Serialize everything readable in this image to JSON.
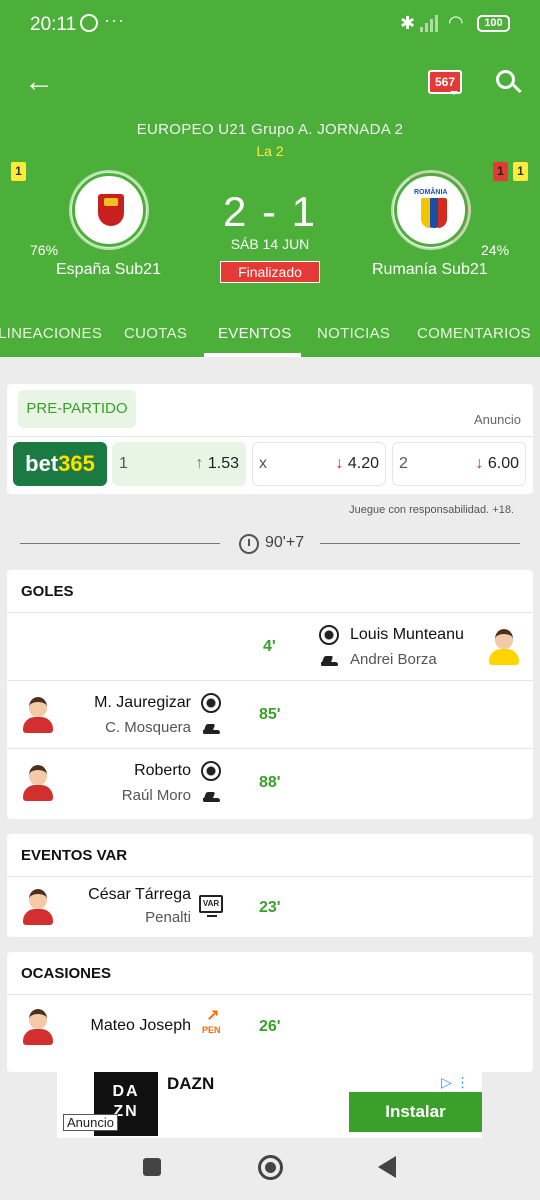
{
  "status_bar": {
    "time": "20:11",
    "dots": "···",
    "battery": "100"
  },
  "header": {
    "chat_count": "567",
    "competition": "EUROPEO U21 Grupo A.  JORNADA 2",
    "round": "La 2"
  },
  "match": {
    "home": {
      "name": "España Sub21",
      "pct": "76%",
      "yellow_cards": "1"
    },
    "away": {
      "name": "Rumanía Sub21",
      "pct": "24%",
      "red_cards": "1",
      "yellow_cards": "1",
      "crest_text": "ROMÂNIA"
    },
    "score": "2 - 1",
    "date": "SÁB 14 JUN",
    "status": "Finalizado",
    "colors": {
      "header_green": "#4caf3a",
      "status_red": "#e53935",
      "round_yellow": "#ffeb3b"
    }
  },
  "tabs": [
    "LINEACIONES",
    "CUOTAS",
    "EVENTOS",
    "NOTICIAS",
    "COMENTARIOS"
  ],
  "active_tab": "EVENTOS",
  "odds": {
    "label": "PRE-PARTIDO",
    "ad_label": "Anuncio",
    "bookmaker_a": "bet",
    "bookmaker_b": "365",
    "items": [
      {
        "key": "1",
        "arrow": "↑",
        "value": "1.53",
        "trend": "up"
      },
      {
        "key": "x",
        "arrow": "↓",
        "value": "4.20",
        "trend": "down"
      },
      {
        "key": "2",
        "arrow": "↓",
        "value": "6.00",
        "trend": "down"
      }
    ],
    "responsible": "Juegue con responsabilidad. +18."
  },
  "timer": {
    "minute": "90'+7"
  },
  "goals": {
    "title": "GOLES",
    "rows": [
      {
        "side": "away",
        "minute": "4'",
        "scorer": "Louis Munteanu",
        "assist": "Andrei Borza"
      },
      {
        "side": "home",
        "minute": "85'",
        "scorer": "M. Jauregizar",
        "assist": "C. Mosquera"
      },
      {
        "side": "home",
        "minute": "88'",
        "scorer": "Roberto",
        "assist": "Raúl Moro"
      }
    ]
  },
  "var_events": {
    "title": "EVENTOS VAR",
    "rows": [
      {
        "side": "home",
        "minute": "23'",
        "player": "César Tárrega",
        "detail": "Penalti",
        "icon_label": "VAR"
      }
    ]
  },
  "chances": {
    "title": "OCASIONES",
    "rows": [
      {
        "side": "home",
        "minute": "26'",
        "player": "Mateo Joseph",
        "icon_label": "PEN"
      }
    ]
  },
  "ad": {
    "brand": "DAZN",
    "logo": "DA\nZN",
    "cta": "Instalar",
    "tag": "Anuncio",
    "choice": "▷ ⋮"
  }
}
